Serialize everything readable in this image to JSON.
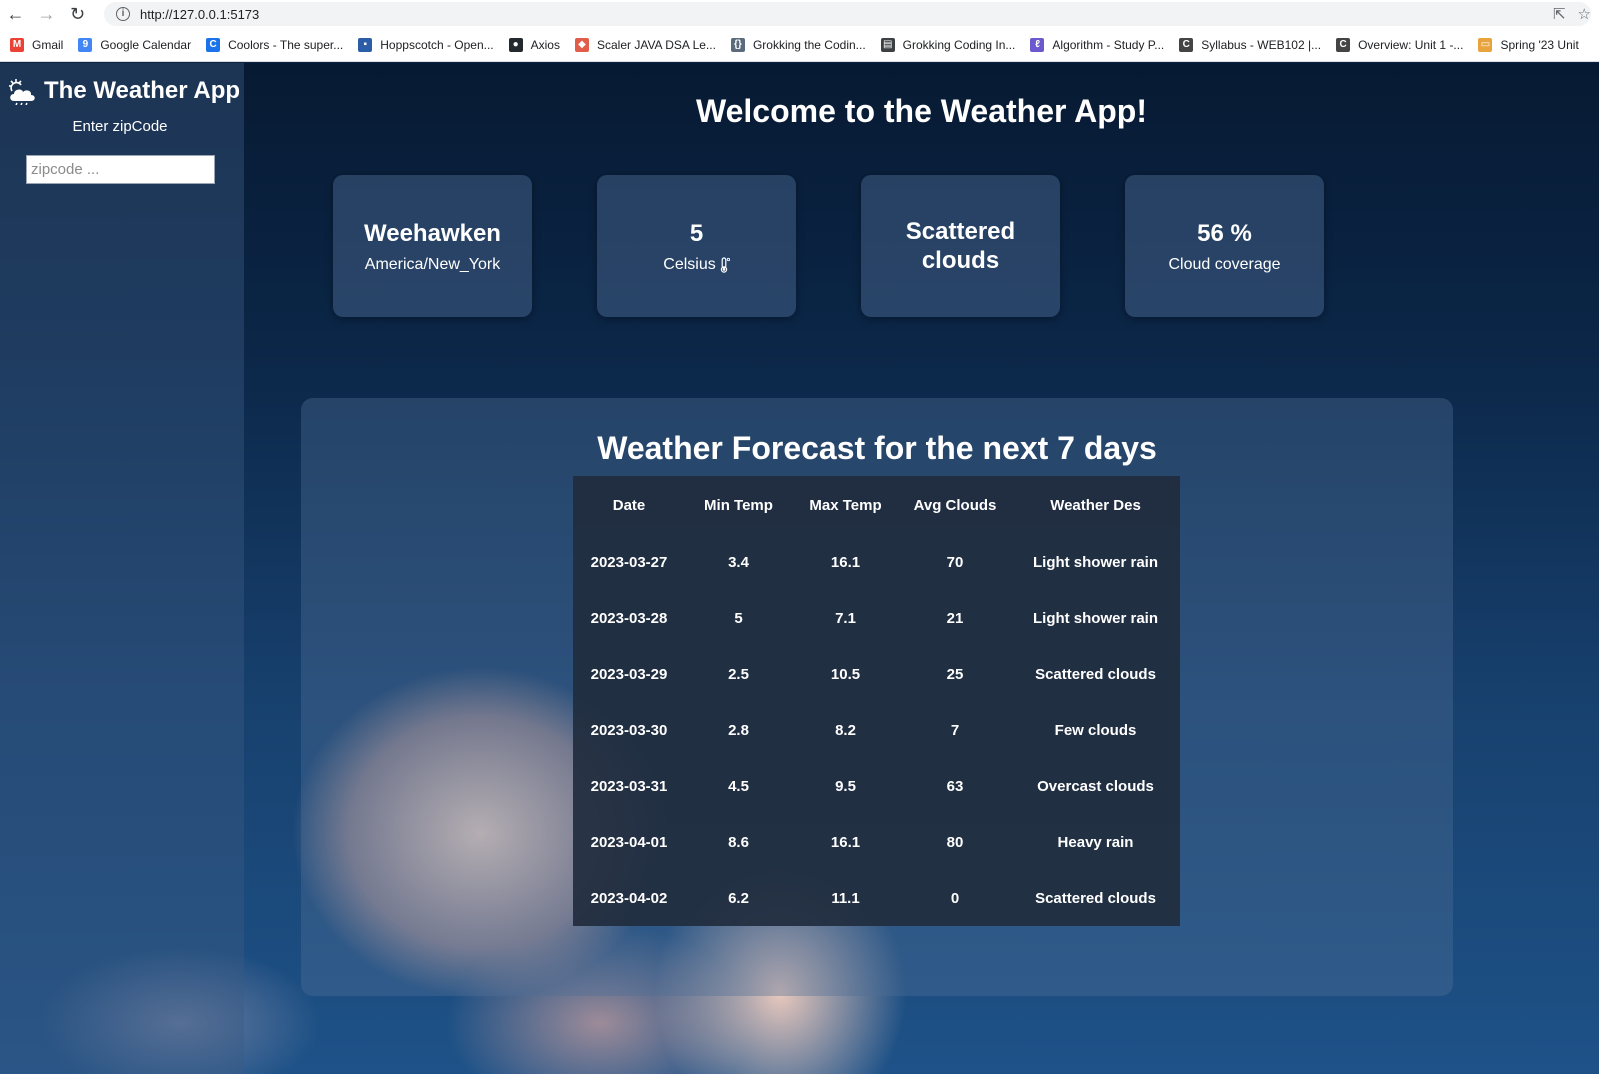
{
  "browser": {
    "url": "http://127.0.0.1:5173",
    "bookmarks": [
      {
        "label": "Gmail",
        "icon": "gmail-icon",
        "color": "#ea4335",
        "glyph": "M"
      },
      {
        "label": "Google Calendar",
        "icon": "calendar-icon",
        "color": "#4285f4",
        "glyph": "9"
      },
      {
        "label": "Coolors - The super...",
        "icon": "coolors-icon",
        "color": "#1a73e8",
        "glyph": "C"
      },
      {
        "label": "Hoppscotch - Open...",
        "icon": "hoppscotch-icon",
        "color": "#2b5ea7",
        "glyph": "▪"
      },
      {
        "label": "Axios",
        "icon": "github-icon",
        "color": "#24292f",
        "glyph": "●"
      },
      {
        "label": "Scaler JAVA DSA Le...",
        "icon": "scaler-icon",
        "color": "#e25c4a",
        "glyph": "◆"
      },
      {
        "label": "Grokking the Codin...",
        "icon": "grokking-icon",
        "color": "#5b6b7c",
        "glyph": "{}"
      },
      {
        "label": "Grokking Coding In...",
        "icon": "terminal-icon",
        "color": "#3c4043",
        "glyph": "▤"
      },
      {
        "label": "Algorithm - Study P...",
        "icon": "algorithm-icon",
        "color": "#6a5acd",
        "glyph": "ℓ"
      },
      {
        "label": "Syllabus - WEB102 |...",
        "icon": "syllabus-icon",
        "color": "#444444",
        "glyph": "C"
      },
      {
        "label": "Overview: Unit 1 -...",
        "icon": "overview-icon",
        "color": "#444444",
        "glyph": "C"
      },
      {
        "label": "Spring '23 Unit",
        "icon": "folder-icon",
        "color": "#e8a33d",
        "glyph": "▭"
      }
    ]
  },
  "sidebar": {
    "title": "The Weather App",
    "zip_label": "Enter zipCode",
    "zip_placeholder": "zipcode ...",
    "zip_value": ""
  },
  "welcome": "Welcome to the Weather App!",
  "cards": [
    {
      "main": "Weehawken",
      "sub": "America/New_York"
    },
    {
      "main": "5",
      "sub": "Celsius"
    },
    {
      "main": "Scattered clouds",
      "sub": ""
    },
    {
      "main": "56 %",
      "sub": "Cloud coverage"
    }
  ],
  "forecast": {
    "title": "Weather Forecast for the next 7 days",
    "columns": [
      "Date",
      "Min Temp",
      "Max Temp",
      "Avg Clouds",
      "Weather Des"
    ],
    "rows": [
      [
        "2023-03-27",
        "3.4",
        "16.1",
        "70",
        "Light shower rain"
      ],
      [
        "2023-03-28",
        "5",
        "7.1",
        "21",
        "Light shower rain"
      ],
      [
        "2023-03-29",
        "2.5",
        "10.5",
        "25",
        "Scattered clouds"
      ],
      [
        "2023-03-30",
        "2.8",
        "8.2",
        "7",
        "Few clouds"
      ],
      [
        "2023-03-31",
        "4.5",
        "9.5",
        "63",
        "Overcast clouds"
      ],
      [
        "2023-04-01",
        "8.6",
        "16.1",
        "80",
        "Heavy rain"
      ],
      [
        "2023-04-02",
        "6.2",
        "11.1",
        "0",
        "Scattered clouds"
      ]
    ]
  }
}
